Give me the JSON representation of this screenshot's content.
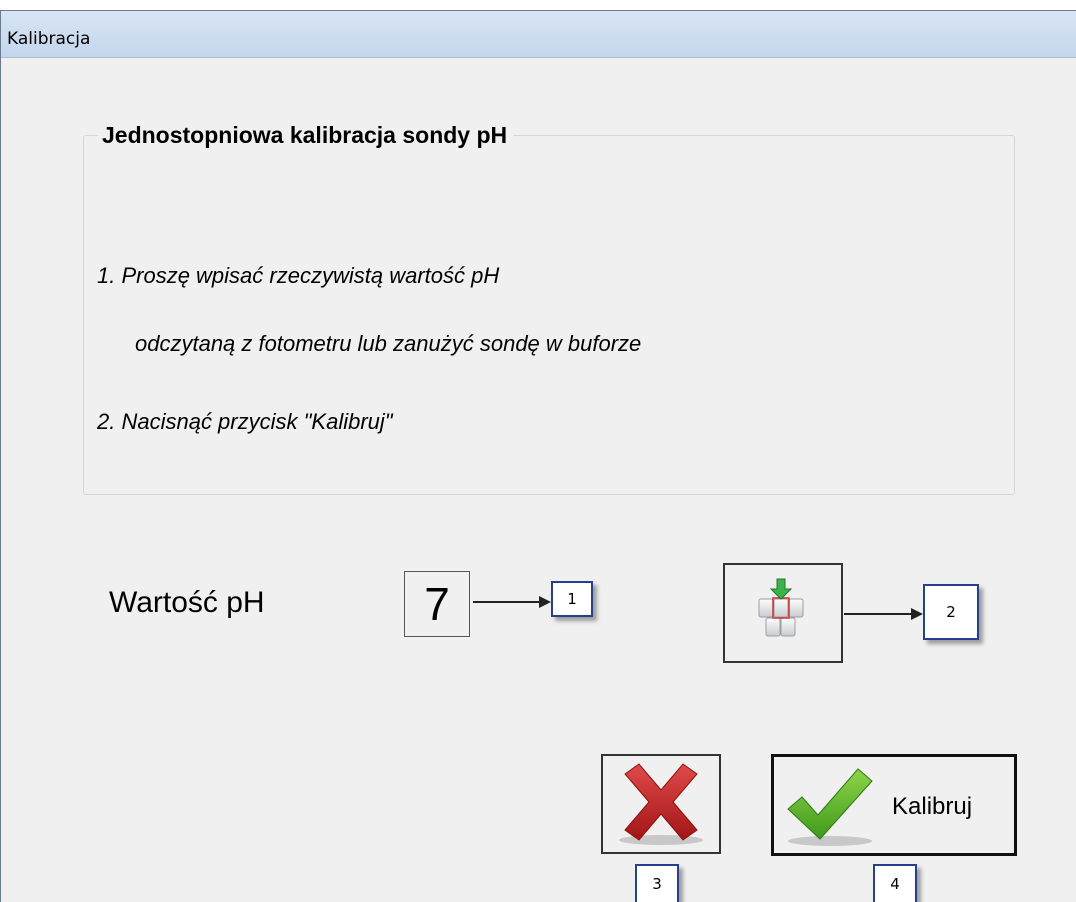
{
  "window": {
    "title": "Kalibracja"
  },
  "group": {
    "title": "Jednostopniowa kalibracja sondy pH",
    "instructions": [
      "1. Proszę wpisać rzeczywistą wartość pH",
      "odczytaną z fotometru lub zanużyć sondę w buforze",
      "2. Nacisnąć przycisk \"Kalibruj\""
    ]
  },
  "ph": {
    "label": "Wartość pH",
    "value": "7"
  },
  "buttons": {
    "keyboard_icon": "keyboard-icon",
    "cancel_icon": "red-x-icon",
    "ok_icon": "green-check-icon",
    "ok_label": "Kalibruj"
  },
  "callouts": [
    "1",
    "2",
    "3",
    "4"
  ]
}
